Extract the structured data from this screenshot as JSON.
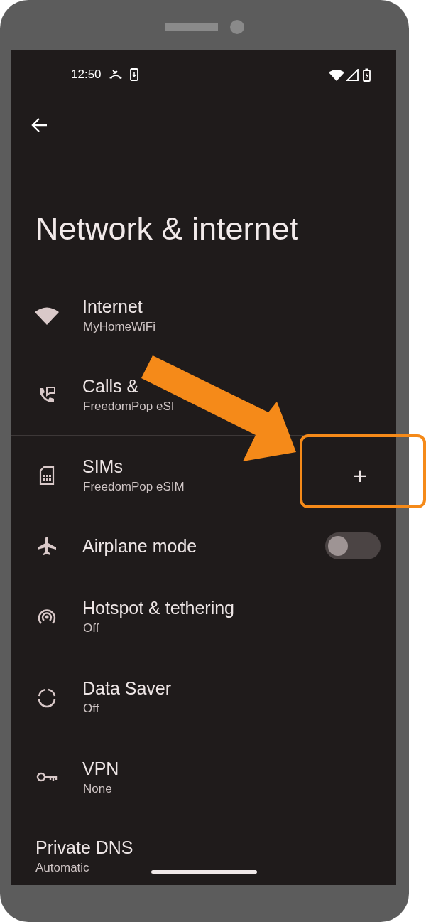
{
  "status_bar": {
    "time": "12:50"
  },
  "title": "Network & internet",
  "sections": [
    {
      "items": [
        {
          "kind": "link",
          "title": "Internet",
          "subtitle": "MyHomeWiFi"
        },
        {
          "kind": "link",
          "title": "Calls &",
          "subtitle": "FreedomPop eSI"
        }
      ]
    },
    {
      "items": [
        {
          "kind": "add",
          "title": "SIMs",
          "subtitle": "FreedomPop eSIM",
          "action": "+"
        },
        {
          "kind": "toggle",
          "title": "Airplane mode",
          "on": false
        },
        {
          "kind": "link",
          "title": "Hotspot & tethering",
          "subtitle": "Off"
        },
        {
          "kind": "link",
          "title": "Data Saver",
          "subtitle": "Off"
        },
        {
          "kind": "link",
          "title": "VPN",
          "subtitle": "None"
        },
        {
          "kind": "link",
          "title": "Private DNS",
          "subtitle": "Automatic"
        }
      ]
    }
  ]
}
